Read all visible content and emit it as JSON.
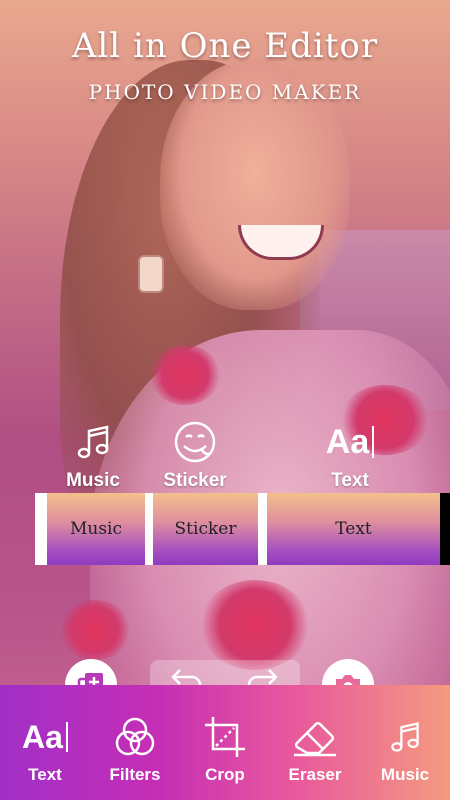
{
  "header": {
    "title": "All in One Editor",
    "subtitle": "PHOTO VIDEO MAKER"
  },
  "tools": [
    {
      "label": "Music",
      "icon": "music-note-icon"
    },
    {
      "label": "Sticker",
      "icon": "sticker-face-icon"
    },
    {
      "label": "Text",
      "icon": "text-aa-icon",
      "icon_text": "Aa"
    }
  ],
  "timeline": {
    "segments": [
      "Music",
      "Sticker",
      "Text"
    ]
  },
  "actions": {
    "add": "add-layer-icon",
    "undo": "undo-icon",
    "redo": "redo-icon",
    "camera": "camera-icon"
  },
  "bottom_nav": [
    {
      "label": "Text",
      "icon": "text-aa-icon",
      "icon_text": "Aa"
    },
    {
      "label": "Filters",
      "icon": "filters-icon"
    },
    {
      "label": "Crop",
      "icon": "crop-icon"
    },
    {
      "label": "Eraser",
      "icon": "eraser-icon"
    },
    {
      "label": "Music",
      "icon": "music-note-icon"
    }
  ],
  "colors": {
    "title_white": "#ffffff",
    "title_highlight": "#f7e600",
    "bottom_gradient_start": "#a12fc7",
    "bottom_gradient_end": "#f59a7f"
  }
}
